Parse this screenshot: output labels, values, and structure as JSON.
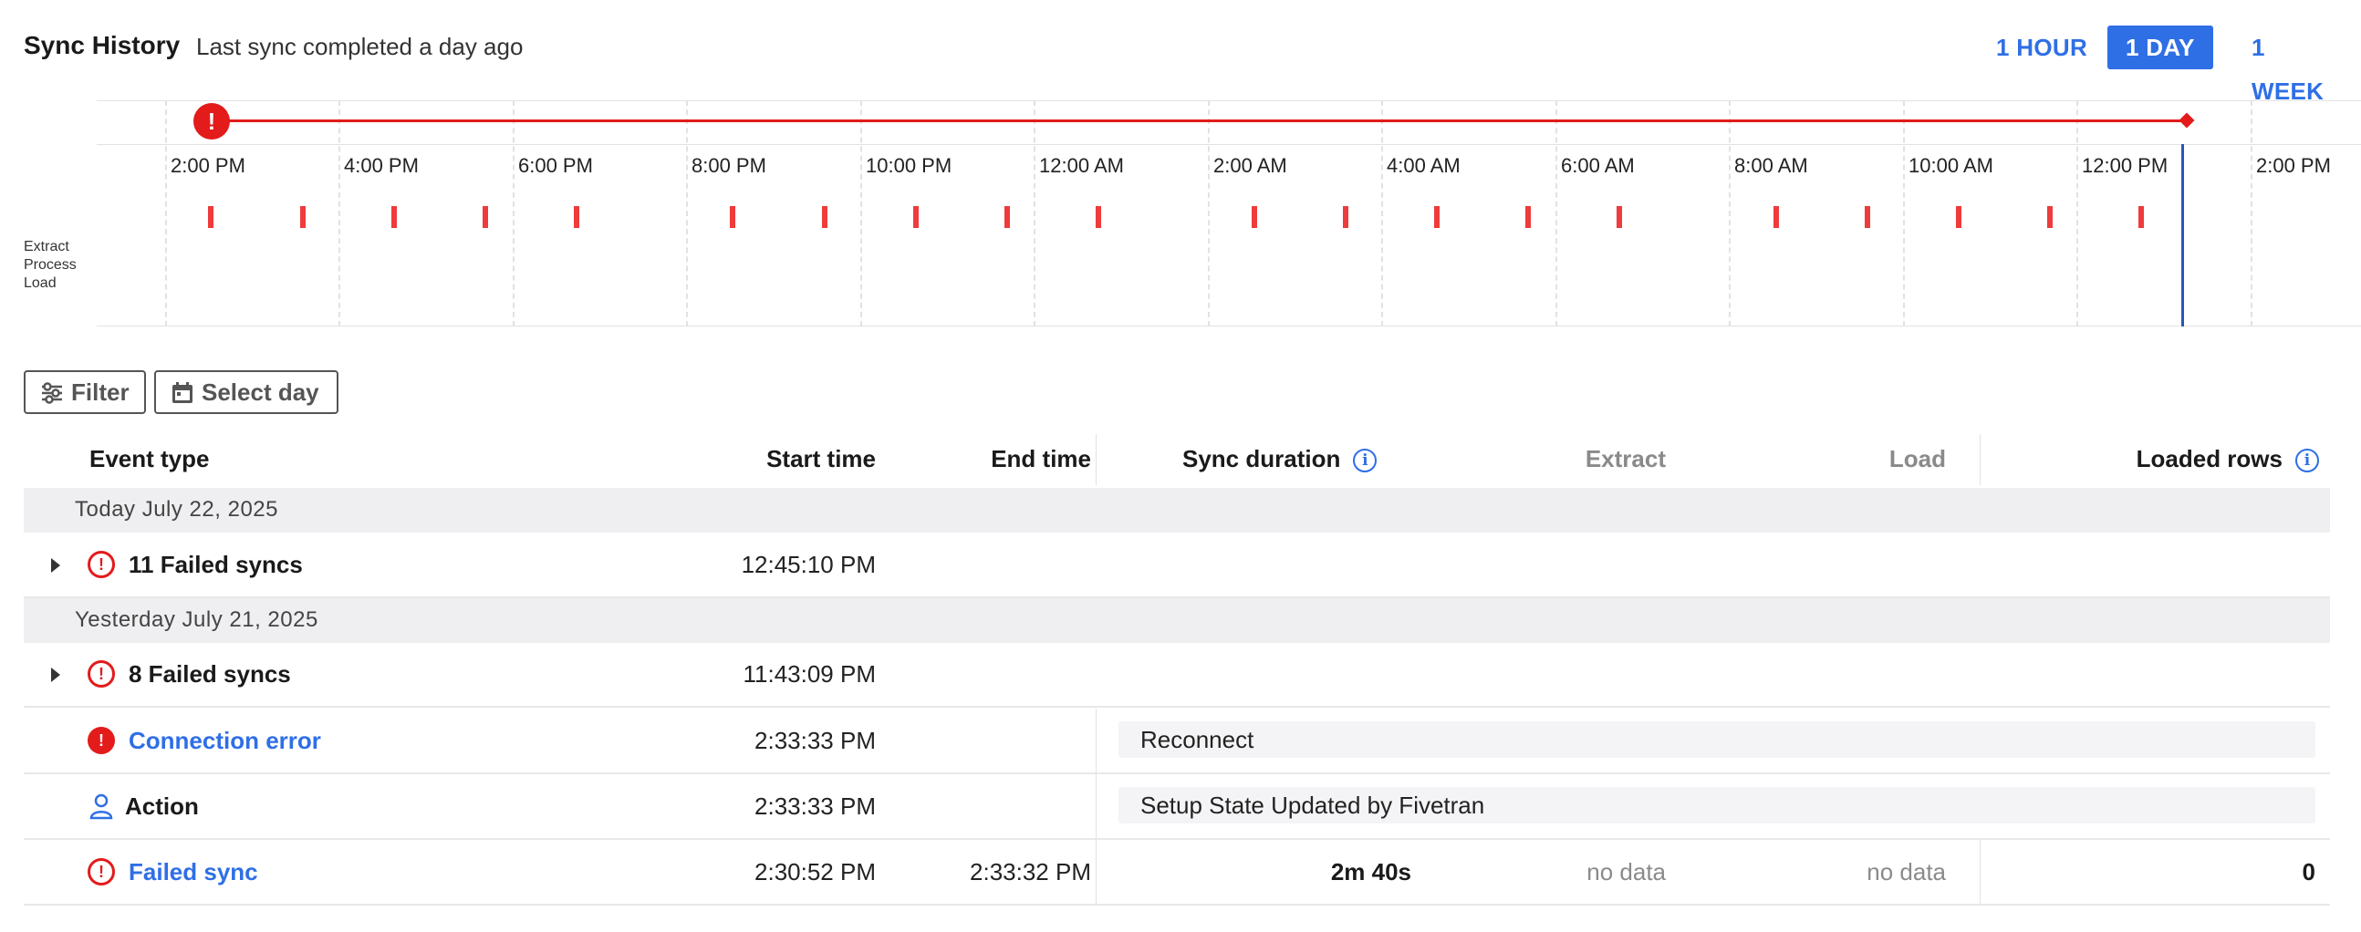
{
  "header": {
    "title": "Sync History",
    "subtitle": "Last sync completed a day ago",
    "ranges": [
      {
        "label": "1 HOUR",
        "active": false
      },
      {
        "label": "1 DAY",
        "active": true
      },
      {
        "label": "1 WEEK",
        "active": false
      }
    ]
  },
  "timeline": {
    "ticks": [
      "2:00 PM",
      "4:00 PM",
      "6:00 PM",
      "8:00 PM",
      "10:00 PM",
      "12:00 AM",
      "2:00 AM",
      "4:00 AM",
      "6:00 AM",
      "8:00 AM",
      "10:00 AM",
      "12:00 PM",
      "2:00 PM"
    ],
    "lanes": [
      "Extract",
      "Process",
      "Load"
    ],
    "error_glyph": "!",
    "colors": {
      "error": "#e31b1b",
      "mark": "#ef3b3b",
      "now_line": "#2a56b8",
      "accent": "#2f6fe6"
    }
  },
  "toolbar": {
    "filter_label": "Filter",
    "select_day_label": "Select day"
  },
  "table": {
    "headers": {
      "event_type": "Event type",
      "start_time": "Start time",
      "end_time": "End time",
      "sync_duration": "Sync duration",
      "extract": "Extract",
      "load": "Load",
      "loaded_rows": "Loaded rows",
      "info_glyph": "i"
    },
    "groups": [
      {
        "label": "Today July 22, 2025"
      },
      {
        "label": "Yesterday July 21, 2025"
      }
    ],
    "rows": [
      {
        "event": "11 Failed syncs",
        "start": "12:45:10 PM",
        "icon": "error-outline-icon",
        "expandable": true
      },
      {
        "event": "8 Failed syncs",
        "start": "11:43:09 PM",
        "icon": "error-outline-icon",
        "expandable": true
      },
      {
        "event": "Connection error",
        "start": "2:33:33 PM",
        "icon": "error-filled-icon",
        "message": "Reconnect"
      },
      {
        "event": "Action",
        "start": "2:33:33 PM",
        "icon": "user-icon",
        "message": "Setup State Updated by Fivetran"
      },
      {
        "event": "Failed sync",
        "start": "2:30:52 PM",
        "end": "2:33:32 PM",
        "duration": "2m 40s",
        "extract": "no data",
        "load": "no data",
        "loaded_rows": "0",
        "icon": "error-outline-icon"
      }
    ]
  }
}
